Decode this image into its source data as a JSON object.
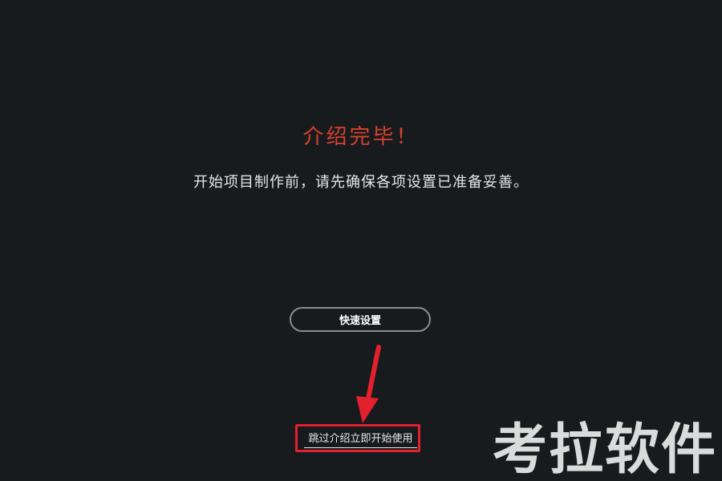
{
  "intro": {
    "title": "介绍完毕！",
    "message": "开始项目制作前，请先确保各项设置已准备妥善。"
  },
  "actions": {
    "quick_setup_label": "快速设置",
    "skip_label": "跳过介绍立即开始使用"
  },
  "watermark": {
    "text": "考拉软件"
  },
  "colors": {
    "background": "#181b1e",
    "title": "#d9412e",
    "annotation": "#e3202d"
  }
}
